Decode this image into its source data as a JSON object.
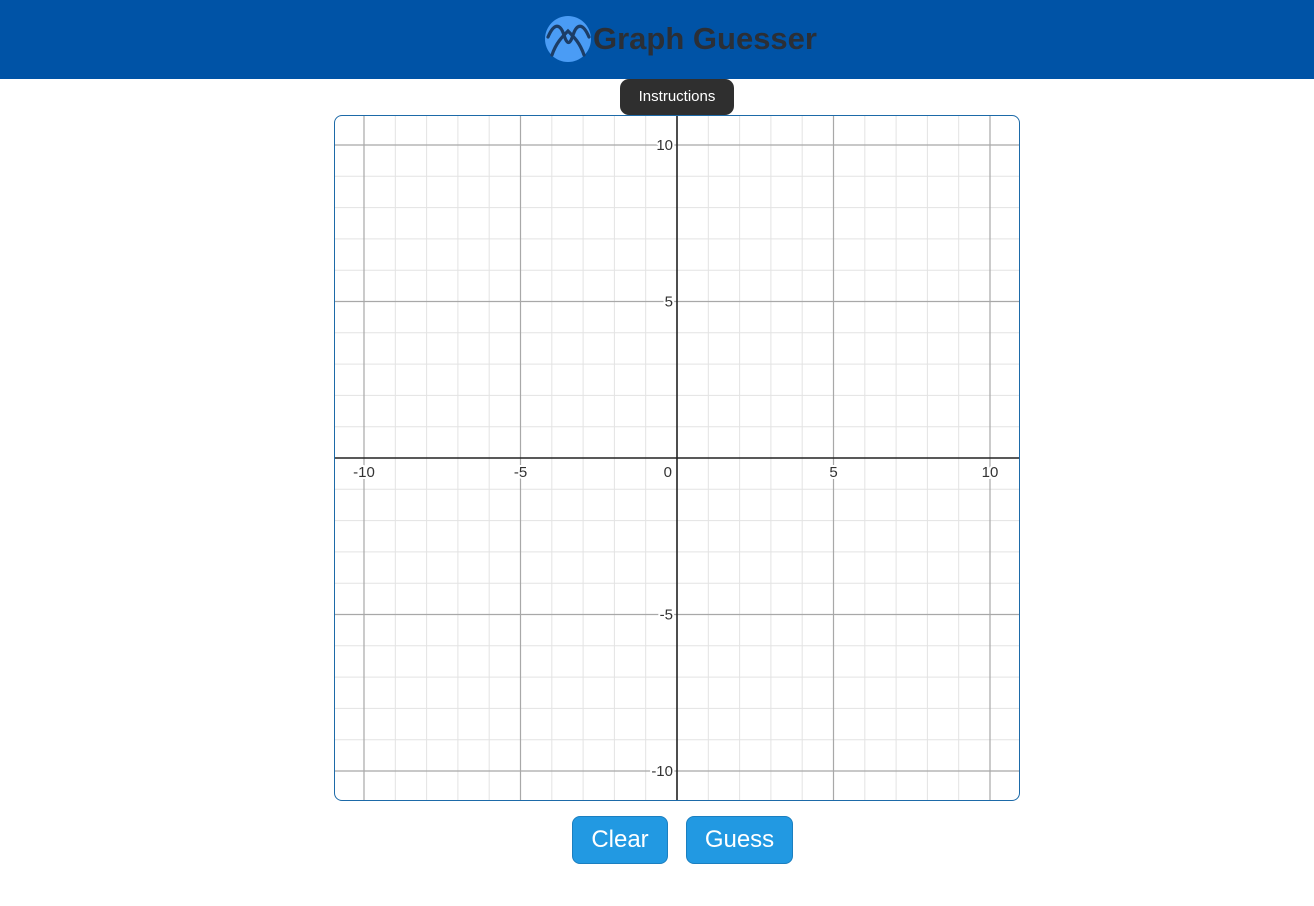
{
  "header": {
    "title": "Graph Guesser",
    "logo_icon": "graph-wave-icon",
    "background_color": "#0053a6",
    "logo_color": "#4a9cf5"
  },
  "instructions_button": {
    "label": "Instructions"
  },
  "graph": {
    "x_range": [
      -10,
      10
    ],
    "y_range": [
      -10,
      10
    ],
    "minor_grid_step": 1,
    "major_grid_step": 5,
    "x_tick_labels": [
      "-10",
      "-5",
      "0",
      "5",
      "10"
    ],
    "y_tick_labels": [
      "10",
      "5",
      "-5",
      "-10"
    ],
    "border_color": "#1d6aa8"
  },
  "actions": {
    "clear_label": "Clear",
    "guess_label": "Guess",
    "button_color": "#2299e2"
  }
}
